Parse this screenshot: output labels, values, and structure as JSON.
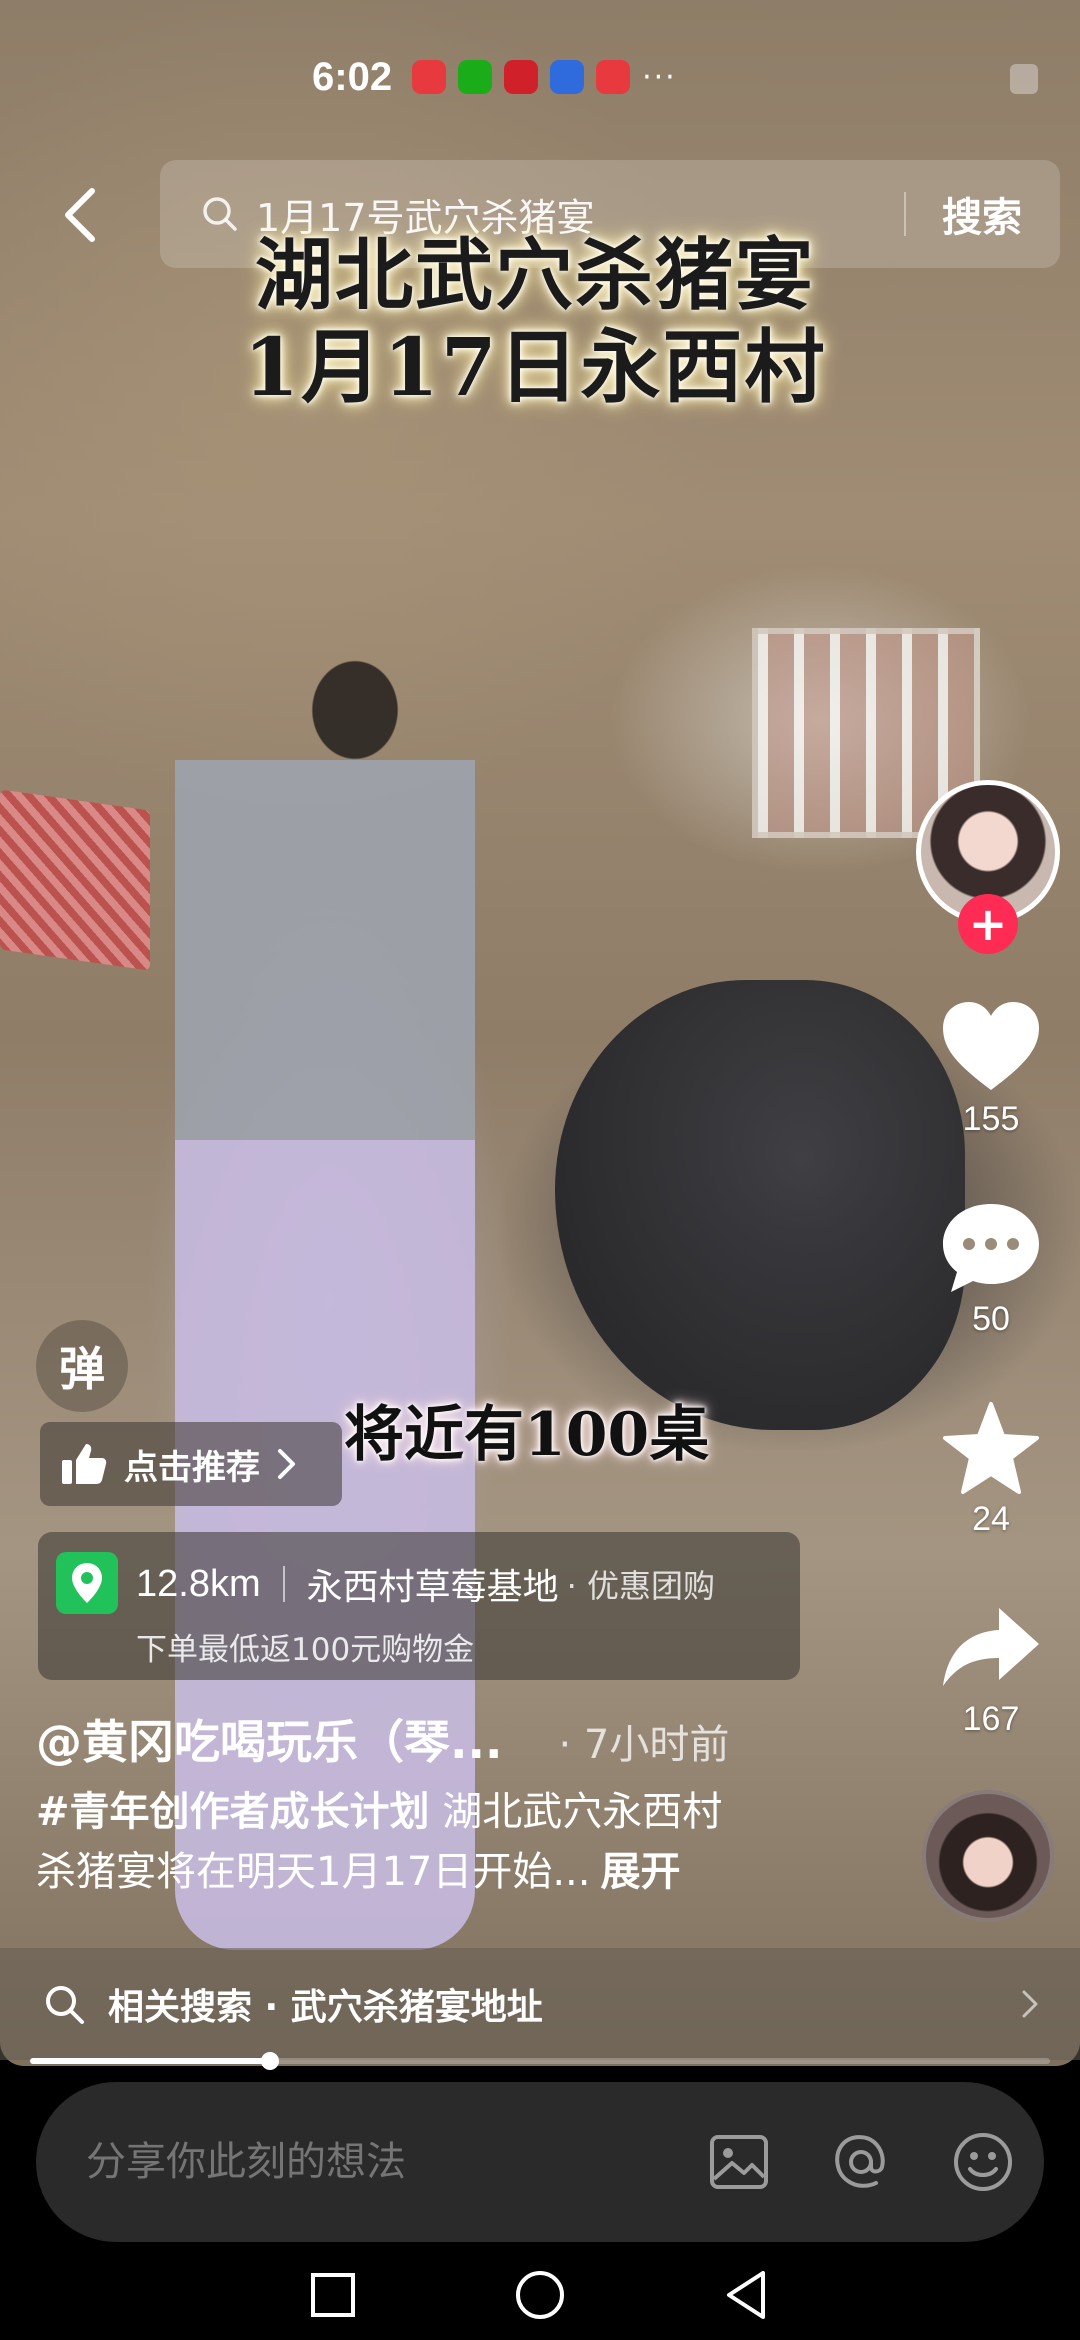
{
  "status_bar": {
    "time": "6:02",
    "more": "···",
    "app_icons": [
      {
        "name": "huawei-app-icon",
        "color": "#e8393f"
      },
      {
        "name": "wechat-icon",
        "color": "#1aad19"
      },
      {
        "name": "byd-app-icon",
        "color": "#d0202a"
      },
      {
        "name": "blue-app-icon",
        "color": "#2f6bdc"
      },
      {
        "name": "huawei-app-icon-2",
        "color": "#e8393f"
      }
    ]
  },
  "search": {
    "query": "1月17号武穴杀猪宴",
    "button_label": "搜索"
  },
  "video": {
    "overlay_line1": "湖北武穴杀猪宴",
    "overlay_line2": "1月17日永西村",
    "mid_caption": "将近有100桌"
  },
  "rail": {
    "likes": "155",
    "comments": "50",
    "favorites": "24",
    "shares": "167",
    "follow_symbol": "+"
  },
  "danmu_label": "弹",
  "recommend": {
    "label": "点击推荐"
  },
  "poi": {
    "distance": "12.8km",
    "name": "永西村草莓基地",
    "tag": "· 优惠团购",
    "subtitle": "下单最低返100元购物金"
  },
  "post": {
    "author": "@黄冈吃喝玩乐（琴...",
    "time": "· 7小时前",
    "hashtag": "#青年创作者成长计划",
    "text_part1": " 湖北武穴永西村",
    "text_part2": "杀猪宴将在明天1月17日开始...",
    "expand": "展开"
  },
  "related_search": {
    "label": "相关搜索 · 武穴杀猪宴地址"
  },
  "progress": {
    "fraction": 0.235
  },
  "comment_bar": {
    "placeholder": "分享你此刻的想法"
  },
  "colors": {
    "accent_red": "#fe2c55",
    "poi_green": "#22c25b"
  }
}
